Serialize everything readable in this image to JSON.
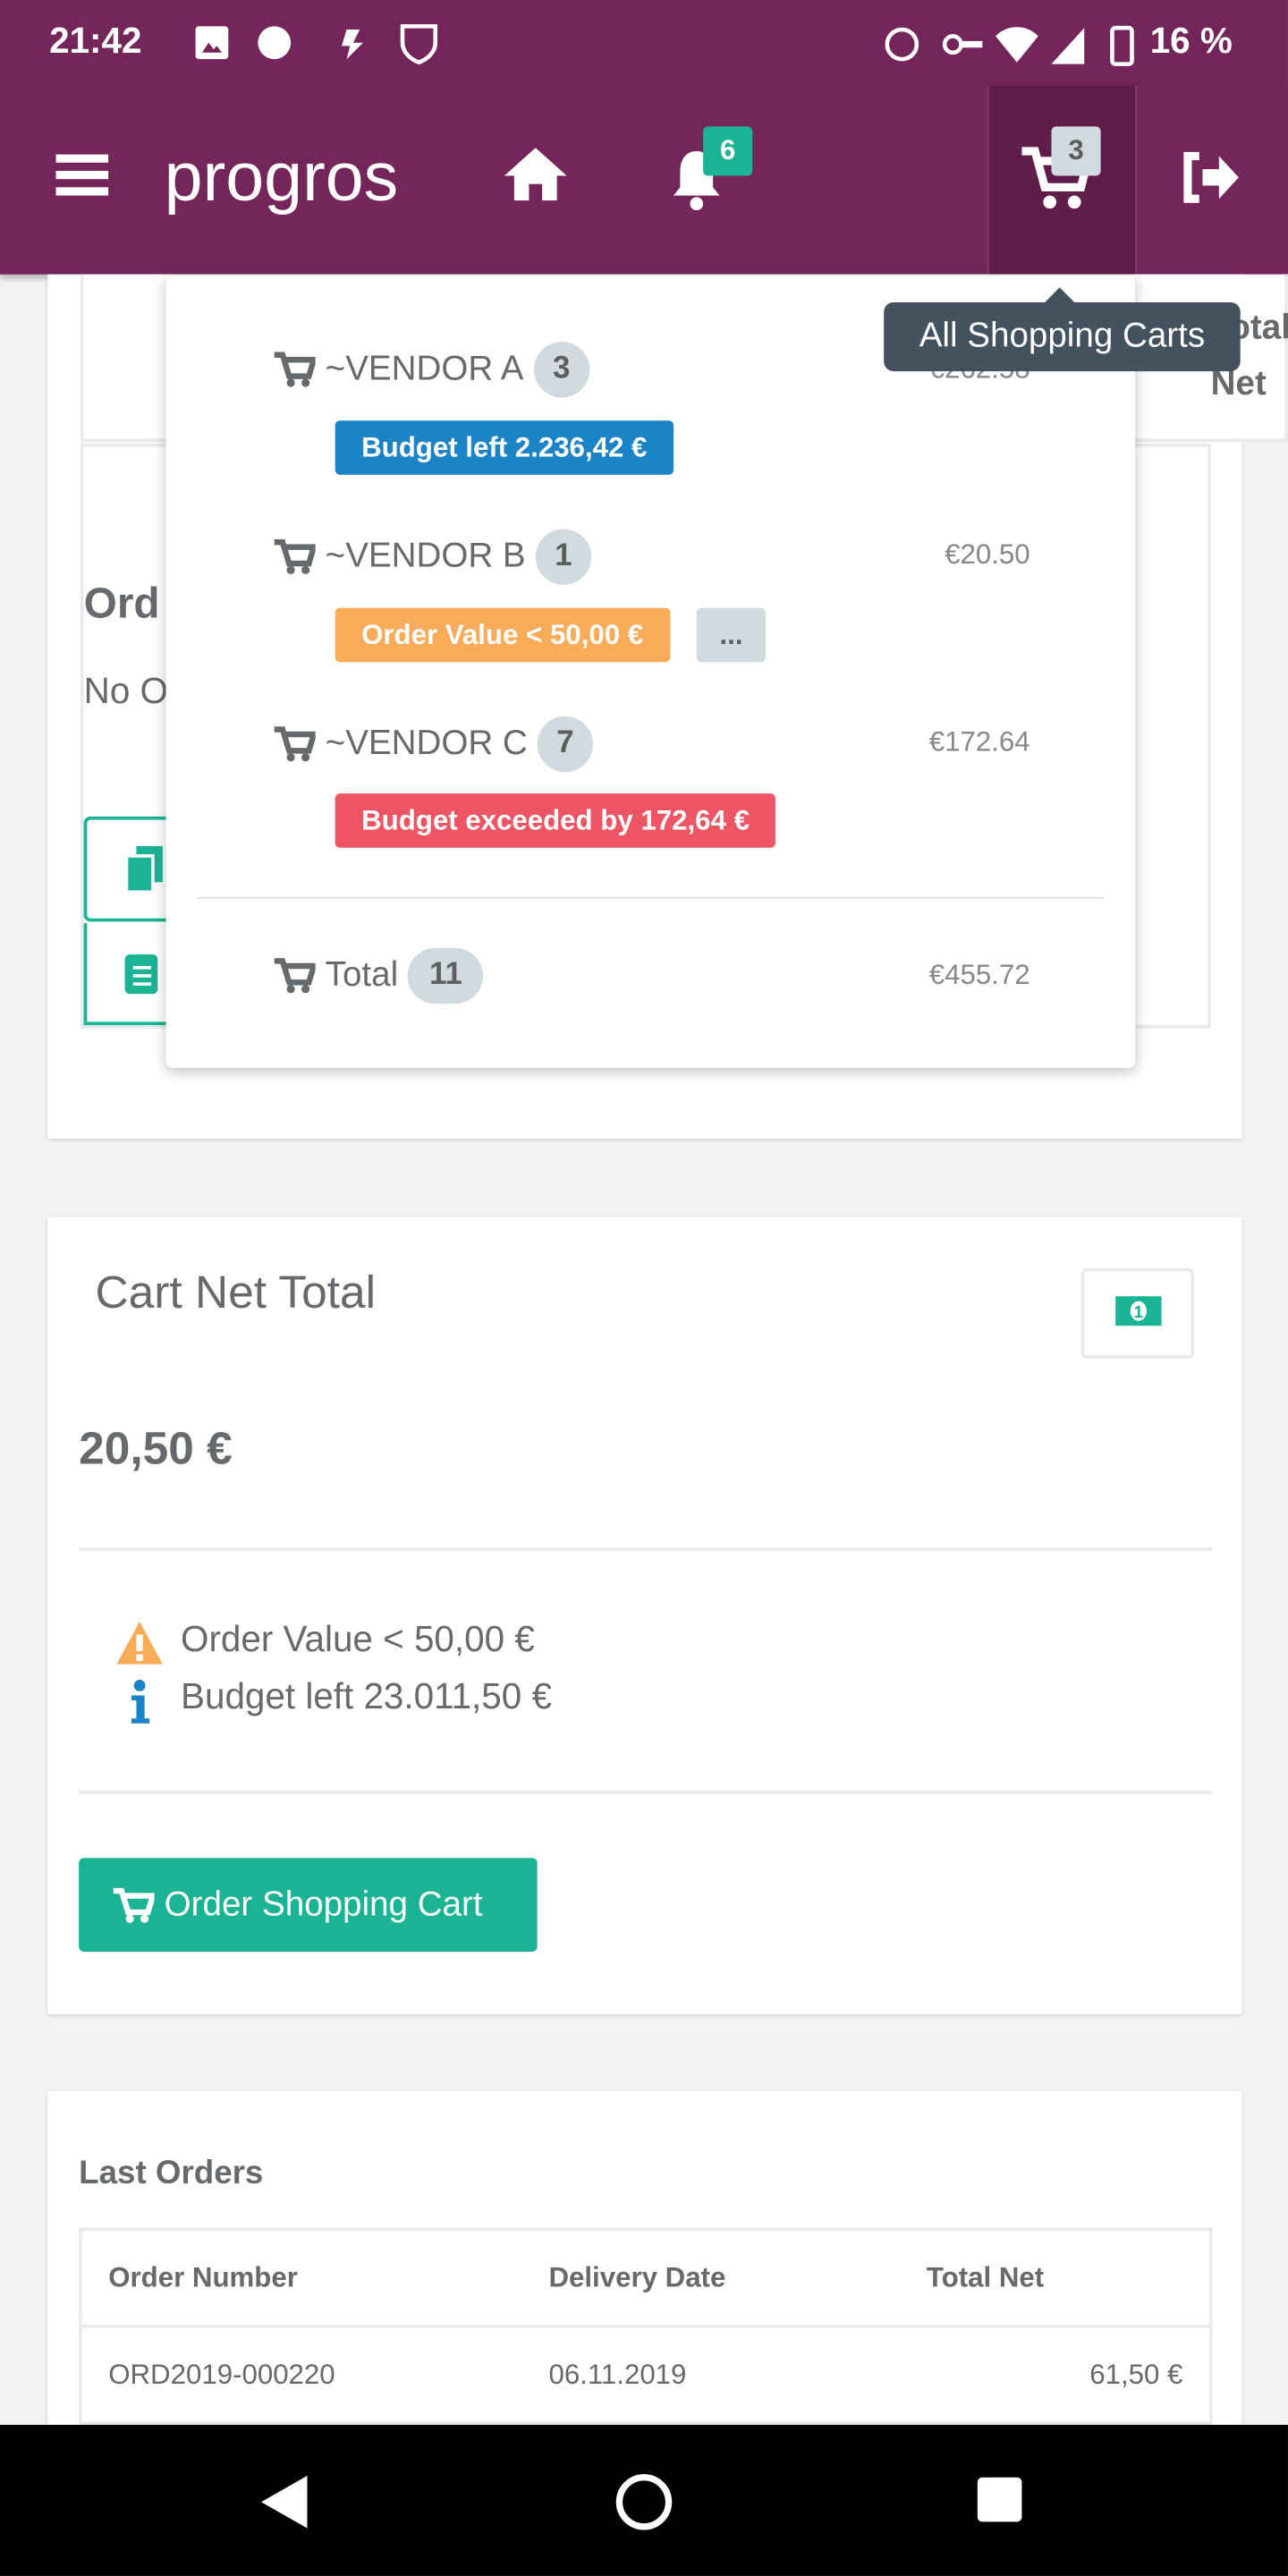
{
  "status_bar": {
    "time": "21:42",
    "battery": "16 %"
  },
  "header": {
    "brand": "progros",
    "notification_count": "6",
    "cart_count": "3"
  },
  "tooltip": "All Shopping Carts",
  "cart_dropdown": {
    "vendors": [
      {
        "name": "~VENDOR A",
        "count": "3",
        "price": "€262.58",
        "label": "Budget left 2.236,42 €",
        "label_color": "#1c84c6"
      },
      {
        "name": "~VENDOR B",
        "count": "1",
        "price": "€20.50",
        "label": "Order Value < 50,00 €",
        "label_color": "#f8ac59",
        "more": "..."
      },
      {
        "name": "~VENDOR C",
        "count": "7",
        "price": "€172.64",
        "label": "Budget exceeded by 172,64 €",
        "label_color": "#ed5565"
      }
    ],
    "total": {
      "label": "Total",
      "count": "11",
      "price": "€455.72"
    }
  },
  "background_card": {
    "partial_heading": "Ord",
    "partial_text": "No O",
    "partial_column": "Total Net"
  },
  "cart_net_total": {
    "title": "Cart Net Total",
    "amount": "20,50 €",
    "warning": "Order Value < 50,00 €",
    "info": "Budget left 23.011,50 €",
    "order_button": "Order Shopping Cart"
  },
  "last_orders": {
    "title": "Last Orders",
    "columns": [
      "Order Number",
      "Delivery Date",
      "Total Net"
    ],
    "rows": [
      [
        "ORD2019-000220",
        "06.11.2019",
        "61,50 €"
      ]
    ]
  },
  "colors": {
    "brand": "#74265a",
    "primary": "#1ab394",
    "info": "#1c84c6",
    "warning": "#f8ac59",
    "danger": "#ed5565"
  }
}
